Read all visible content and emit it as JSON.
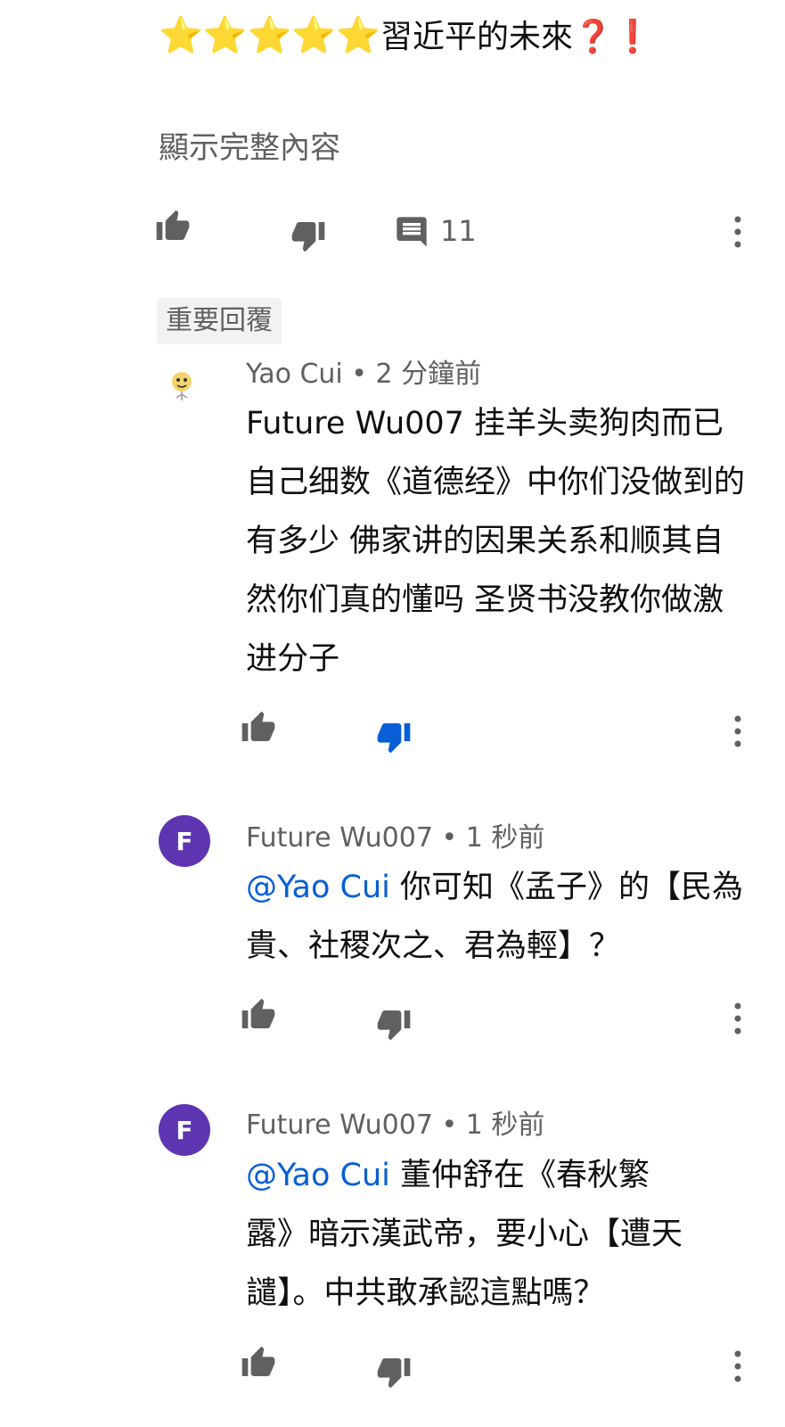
{
  "parent": {
    "stars": "⭐⭐⭐⭐⭐",
    "text": "習近平的未來",
    "marks": "❓❗",
    "show_more": "顯示完整內容",
    "reply_count": "11"
  },
  "top_reply_chip": "重要回覆",
  "replies": [
    {
      "author": "Yao Cui",
      "time": "2 分鐘前",
      "separator": " • ",
      "mention": "",
      "text": "Future Wu007 挂羊头卖狗肉而已自己细数《道德经》中你们没做到的有多少 佛家讲的因果关系和顺其自然你们真的懂吗 圣贤书没教你做激进分子",
      "disliked": true
    },
    {
      "author": "Future Wu007",
      "time": "1 秒前",
      "separator": " • ",
      "avatar_letter": "F",
      "mention": "@Yao Cui",
      "text": " 你可知《孟子》的【民為貴、社稷次之、君為輕】？",
      "disliked": false
    },
    {
      "author": "Future Wu007",
      "time": "1 秒前",
      "separator": " • ",
      "avatar_letter": "F",
      "mention": "@Yao Cui",
      "text": " 董仲舒在《春秋繁露》暗示漢武帝，要小心【遭天譴】。中共敢承認這點嗎？",
      "disliked": false
    }
  ],
  "colors": {
    "icon_gray": "#606060",
    "dislike_active": "#065fd4",
    "mention": "#065fd4",
    "avatar_purple": "#5e35b1"
  }
}
